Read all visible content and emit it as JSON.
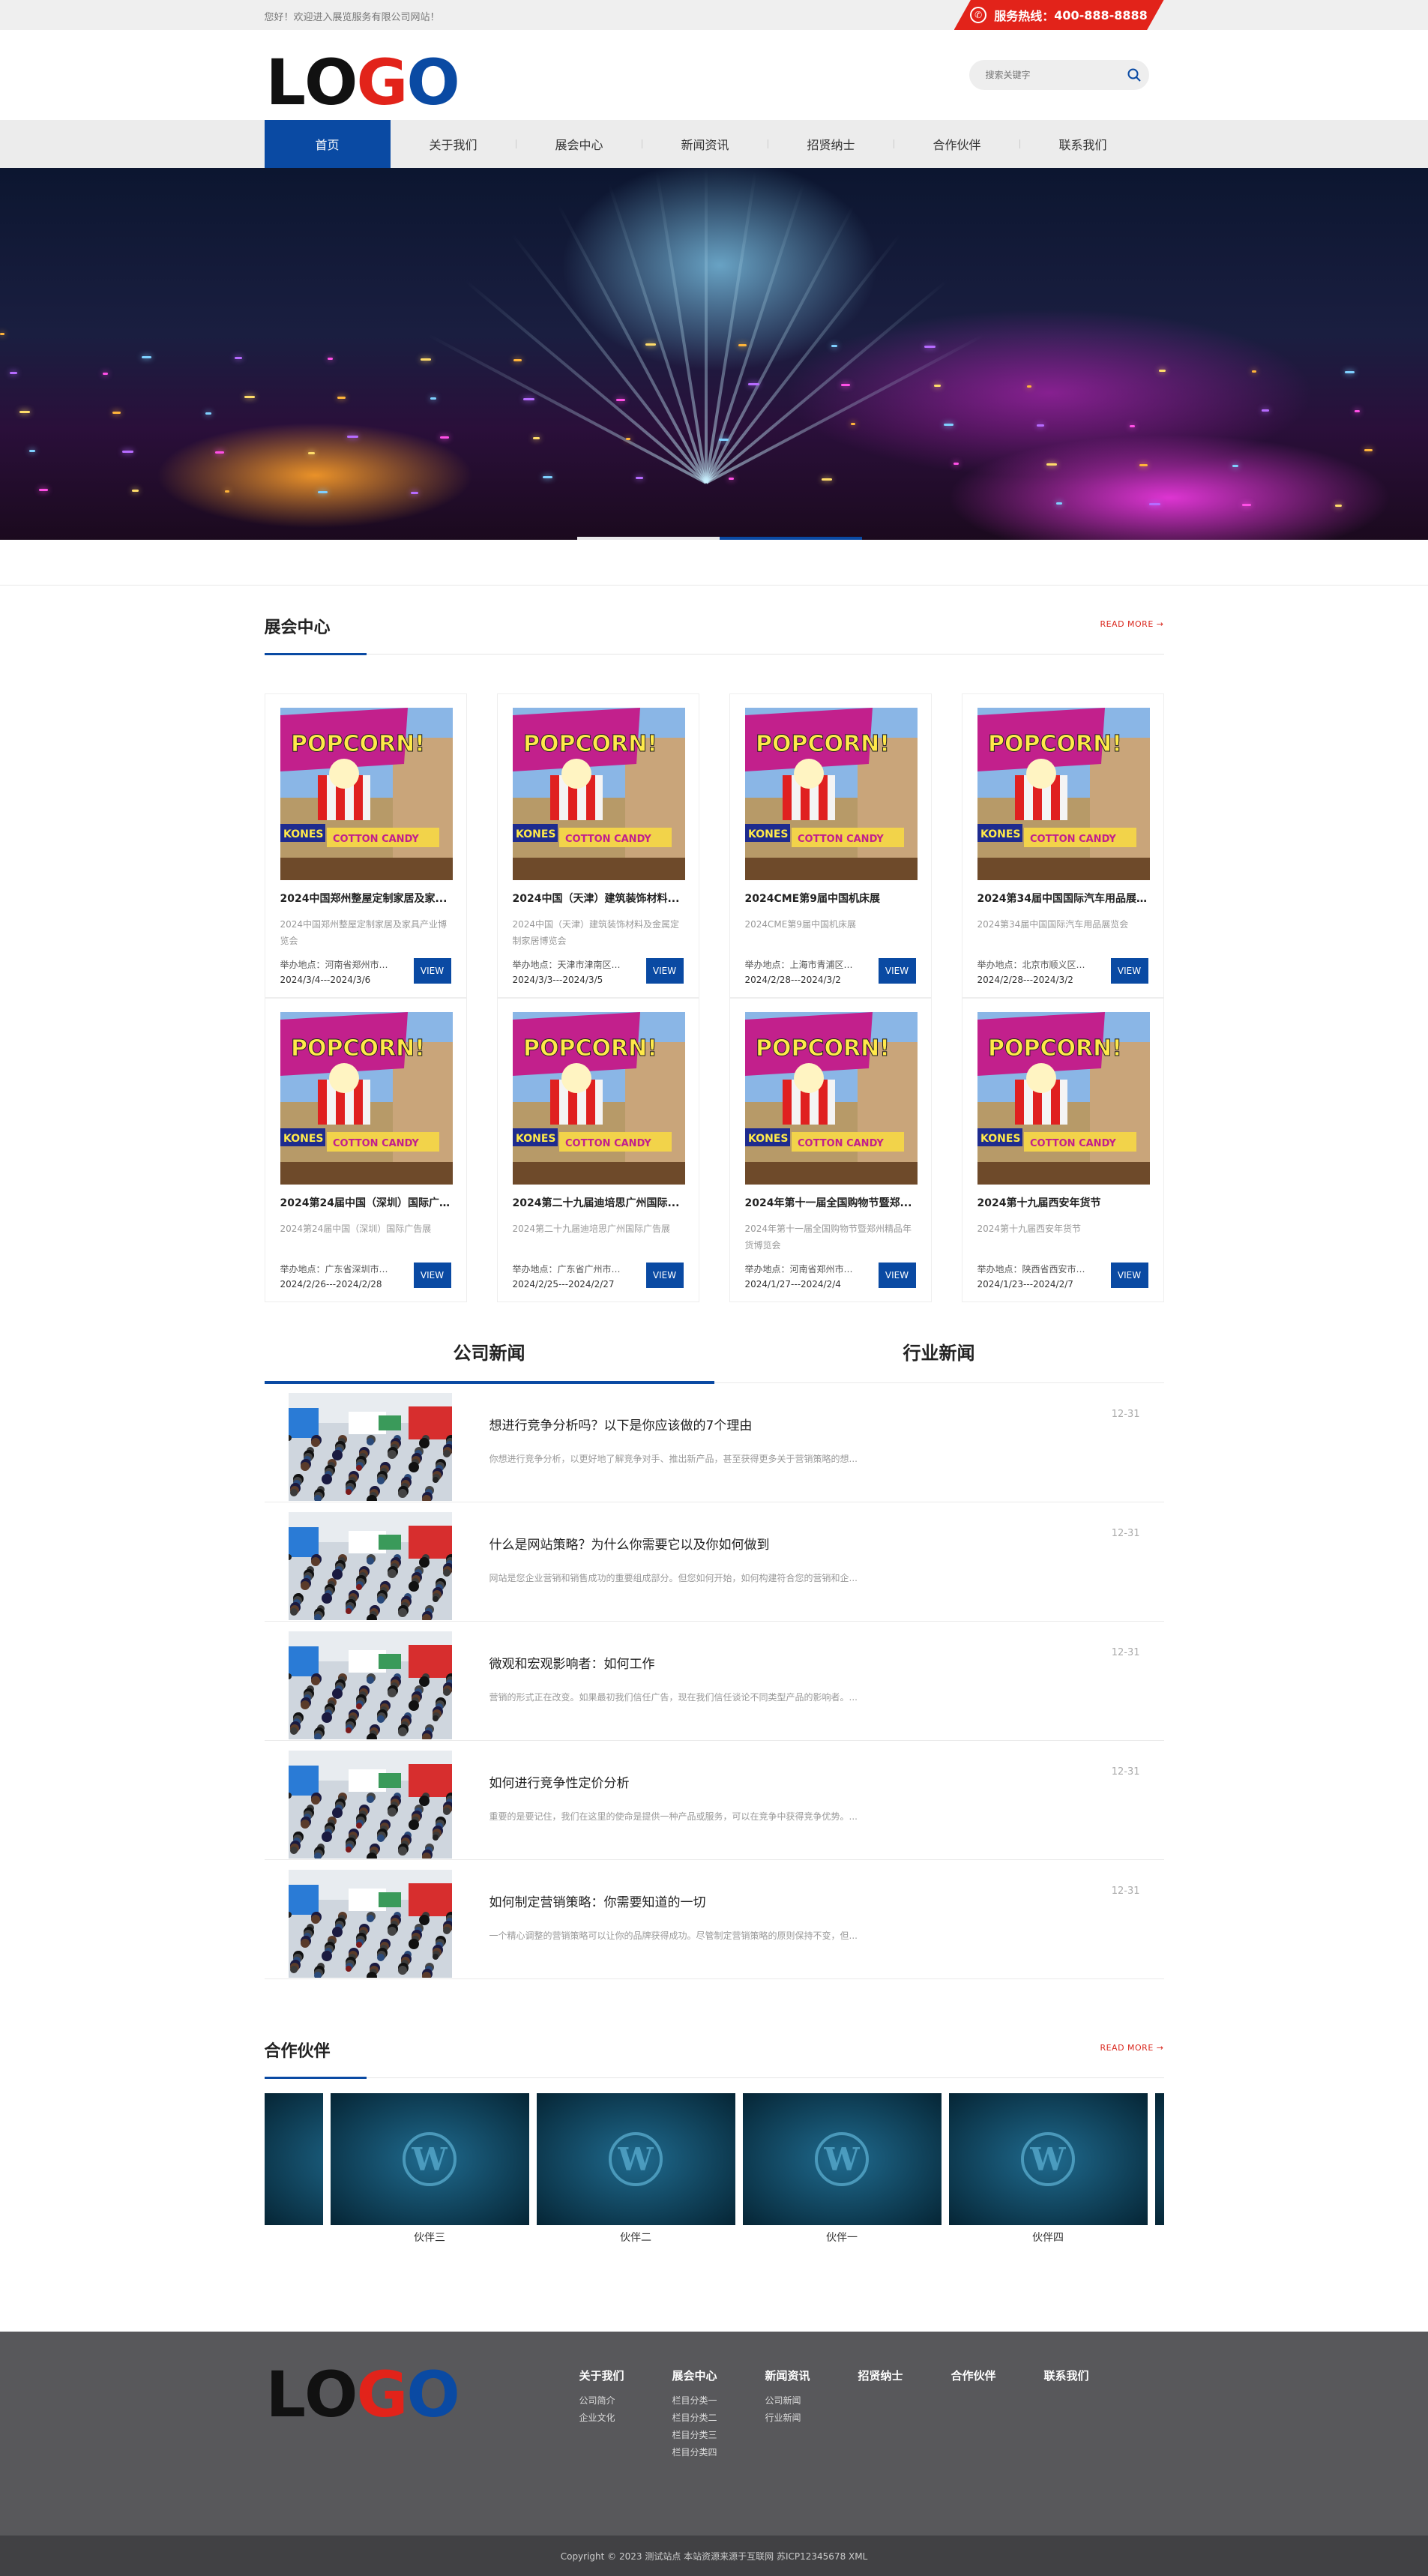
{
  "topbar": {
    "welcome": "您好！欢迎进入展览服务有限公司网站！",
    "hotline_label": "服务热线：",
    "hotline_number": "400-888-8888"
  },
  "header": {
    "logo_letters": [
      "L",
      "O",
      "G",
      "O"
    ],
    "logo_colors": [
      "#111111",
      "#111111",
      "#e2231a",
      "#0a4aa3"
    ],
    "search_placeholder": "搜索关键字"
  },
  "nav": {
    "items": [
      "首页",
      "关于我们",
      "展会中心",
      "新闻资讯",
      "招贤纳士",
      "合作伙伴",
      "联系我们"
    ],
    "active": 0
  },
  "colors": {
    "brand_blue": "#0a4aa3",
    "accent_red": "#e2231a"
  },
  "expo": {
    "title": "展会中心",
    "more": "READ MORE",
    "view_label": "VIEW",
    "items": [
      {
        "title": "2024中国郑州整屋定制家居及家...",
        "desc": "2024中国郑州整屋定制家居及家具产业博览会",
        "place": "举办地点：河南省郑州市郑...",
        "date": "2024/3/4---2024/3/6"
      },
      {
        "title": "2024中国（天津）建筑装饰材料...",
        "desc": "2024中国（天津）建筑装饰材料及金属定制家居博览会",
        "place": "举办地点：天津市津南区观...",
        "date": "2024/3/3---2024/3/5"
      },
      {
        "title": "2024CME第9届中国机床展",
        "desc": "2024CME第9届中国机床展",
        "place": "举办地点：上海市青浦区崧...",
        "date": "2024/2/28---2024/3/2"
      },
      {
        "title": "2024第34届中国国际汽车用品展...",
        "desc": "2024第34届中国国际汽车用品展览会",
        "place": "举办地点：北京市顺义区裕...",
        "date": "2024/2/28---2024/3/2"
      },
      {
        "title": "2024第24届中国（深圳）国际广...",
        "desc": "2024第24届中国（深圳）国际广告展",
        "place": "举办地点：广东省深圳市福...",
        "date": "2024/2/26---2024/2/28"
      },
      {
        "title": "2024第二十九届迪培思广州国际...",
        "desc": "2024第二十九届迪培思广州国际广告展",
        "place": "举办地点：广东省广州市海...",
        "date": "2024/2/25---2024/2/27"
      },
      {
        "title": "2024年第十一届全国购物节暨郑...",
        "desc": "2024年第十一届全国购物节暨郑州精品年货博览会",
        "place": "举办地点：河南省郑州市郑...",
        "date": "2024/1/27---2024/2/4"
      },
      {
        "title": "2024第十九届西安年货节",
        "desc": "2024第十九届西安年货节",
        "place": "举办地点：陕西省西安市雁...",
        "date": "2024/1/23---2024/2/7"
      }
    ]
  },
  "news": {
    "tabs": [
      "公司新闻",
      "行业新闻"
    ],
    "active_tab": 0,
    "items": [
      {
        "title": "想进行竞争分析吗？以下是你应该做的7个理由",
        "desc": "你想进行竞争分析，以更好地了解竞争对手、推出新产品，甚至获得更多关于营销策略的想...",
        "date": "12-31"
      },
      {
        "title": "什么是网站策略？为什么你需要它以及你如何做到",
        "desc": "网站是您企业营销和销售成功的重要组成部分。但您如何开始，如何构建符合您的营销和企...",
        "date": "12-31"
      },
      {
        "title": "微观和宏观影响者：如何工作",
        "desc": "营销的形式正在改变。如果最初我们信任广告，现在我们信任谈论不同类型产品的影响者。...",
        "date": "12-31"
      },
      {
        "title": "如何进行竞争性定价分析",
        "desc": "重要的是要记住，我们在这里的使命是提供一种产品或服务，可以在竞争中获得竞争优势。...",
        "date": "12-31"
      },
      {
        "title": "如何制定营销策略：你需要知道的一切",
        "desc": "一个精心调整的营销策略可以让你的品牌获得成功。尽管制定营销策略的原则保持不变，但...",
        "date": "12-31"
      }
    ]
  },
  "partners": {
    "title": "合作伙伴",
    "more": "READ MORE",
    "items": [
      "伙伴三",
      "伙伴二",
      "伙伴一",
      "伙伴四"
    ]
  },
  "footer": {
    "columns": [
      {
        "title": "关于我们",
        "links": [
          "公司简介",
          "企业文化"
        ]
      },
      {
        "title": "展会中心",
        "links": [
          "栏目分类一",
          "栏目分类二",
          "栏目分类三",
          "栏目分类四"
        ]
      },
      {
        "title": "新闻资讯",
        "links": [
          "公司新闻",
          "行业新闻"
        ]
      },
      {
        "title": "招贤纳士",
        "links": []
      },
      {
        "title": "合作伙伴",
        "links": []
      },
      {
        "title": "联系我们",
        "links": []
      }
    ],
    "copyright": "Copyright © 2023 测试站点 本站资源来源于互联网 苏ICP12345678 XML"
  },
  "icons": {
    "phone": "phone-icon",
    "search": "search-icon",
    "arrow": "arrow-right-icon",
    "partner_logo": "wordpress-icon"
  }
}
